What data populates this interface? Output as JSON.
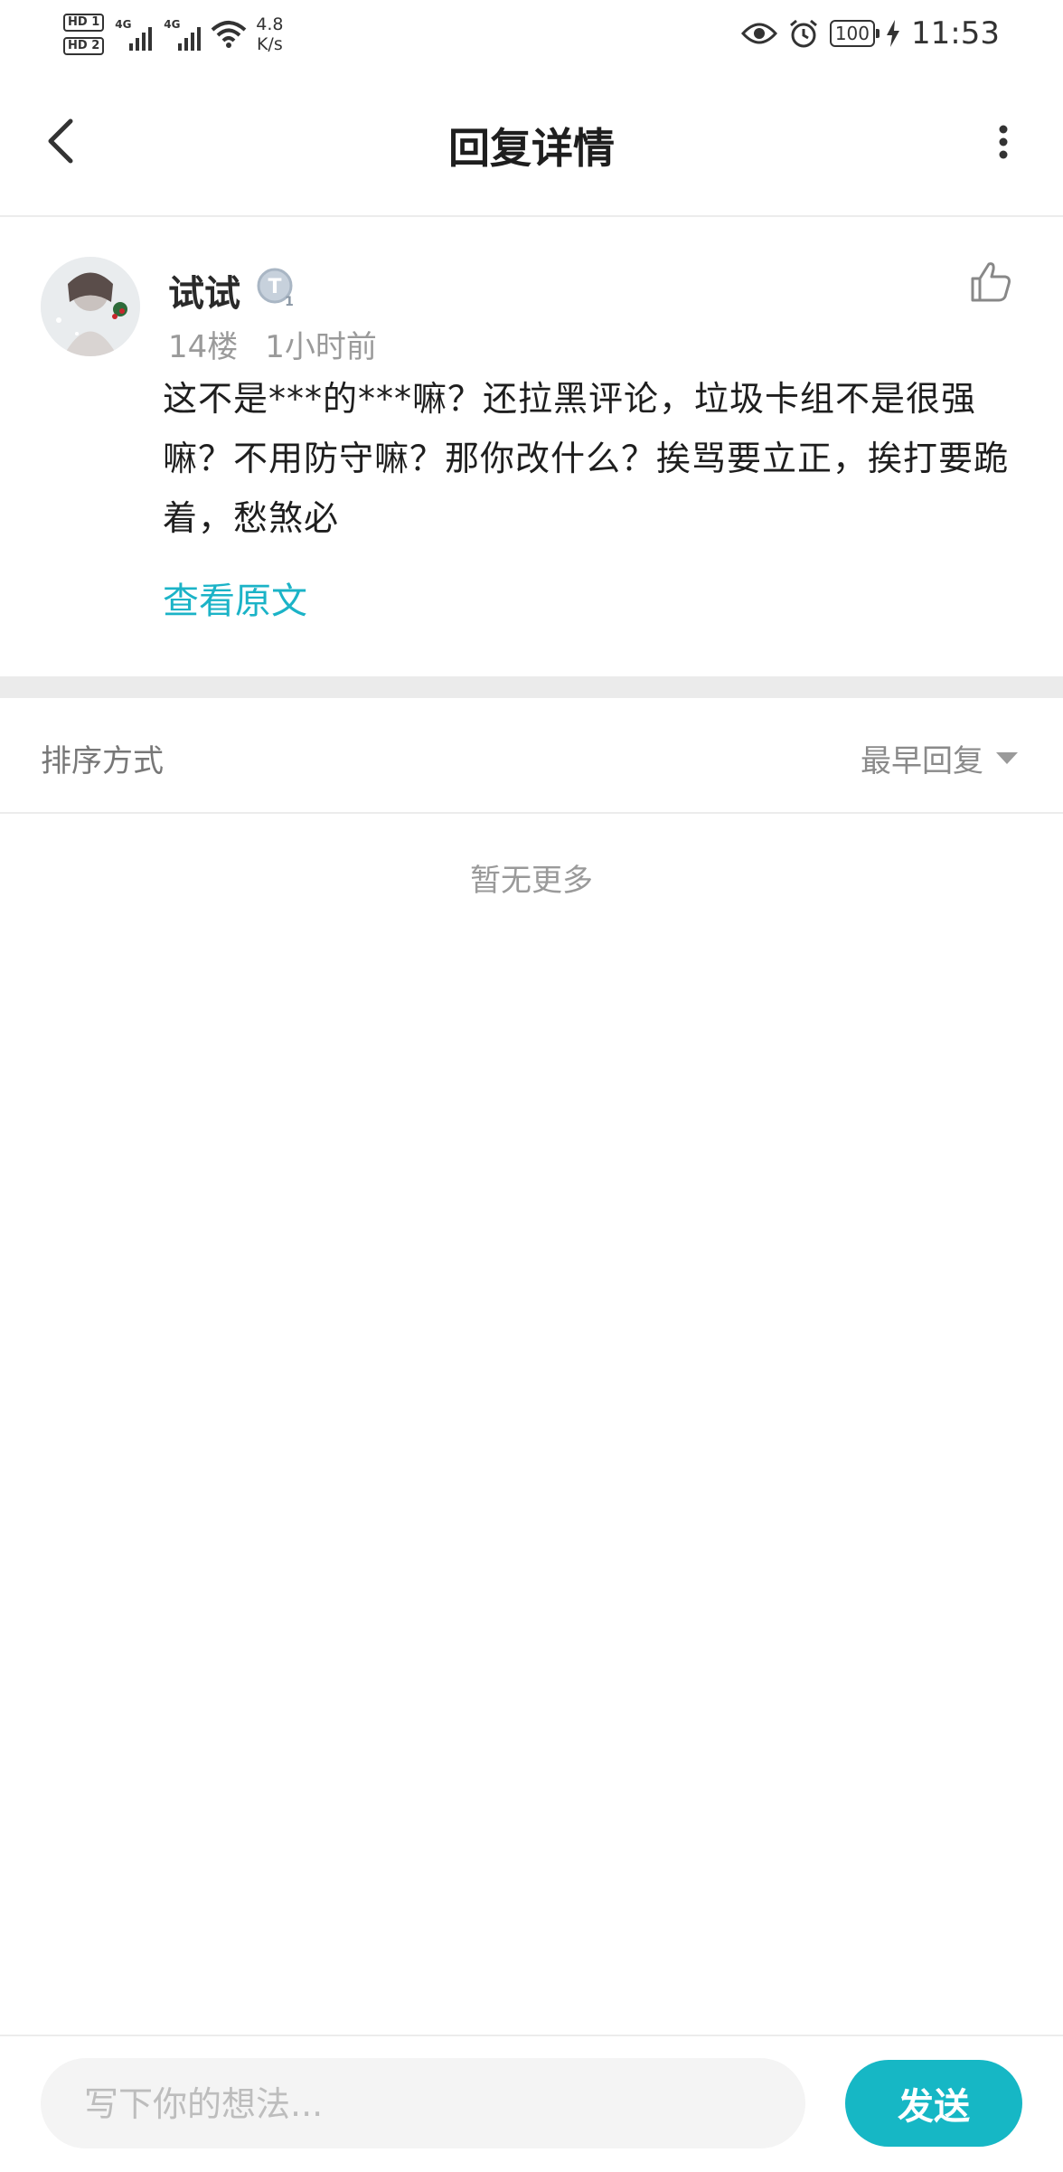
{
  "status_bar": {
    "sim1": "HD 1",
    "sim2": "HD 2",
    "network1": "4G",
    "network2": "4G",
    "speed_value": "4.8",
    "speed_unit": "K/s",
    "battery": "100",
    "time": "11:53"
  },
  "header": {
    "title": "回复详情"
  },
  "comment": {
    "username": "试试",
    "badge_letter": "T",
    "badge_level": "1",
    "floor": "14楼",
    "time": "1小时前",
    "text": "这不是***的***嘛？还拉黑评论，垃圾卡组不是很强嘛？不用防守嘛？那你改什么？挨骂要立正，挨打要跪着，愁煞必",
    "view_original": "查看原文"
  },
  "sort": {
    "label": "排序方式",
    "selected": "最早回复"
  },
  "replies": {
    "empty_text": "暂无更多"
  },
  "composer": {
    "placeholder": "写下你的想法...",
    "send_label": "发送"
  },
  "colors": {
    "accent": "#16b7c5",
    "link": "#1bb3c7"
  }
}
